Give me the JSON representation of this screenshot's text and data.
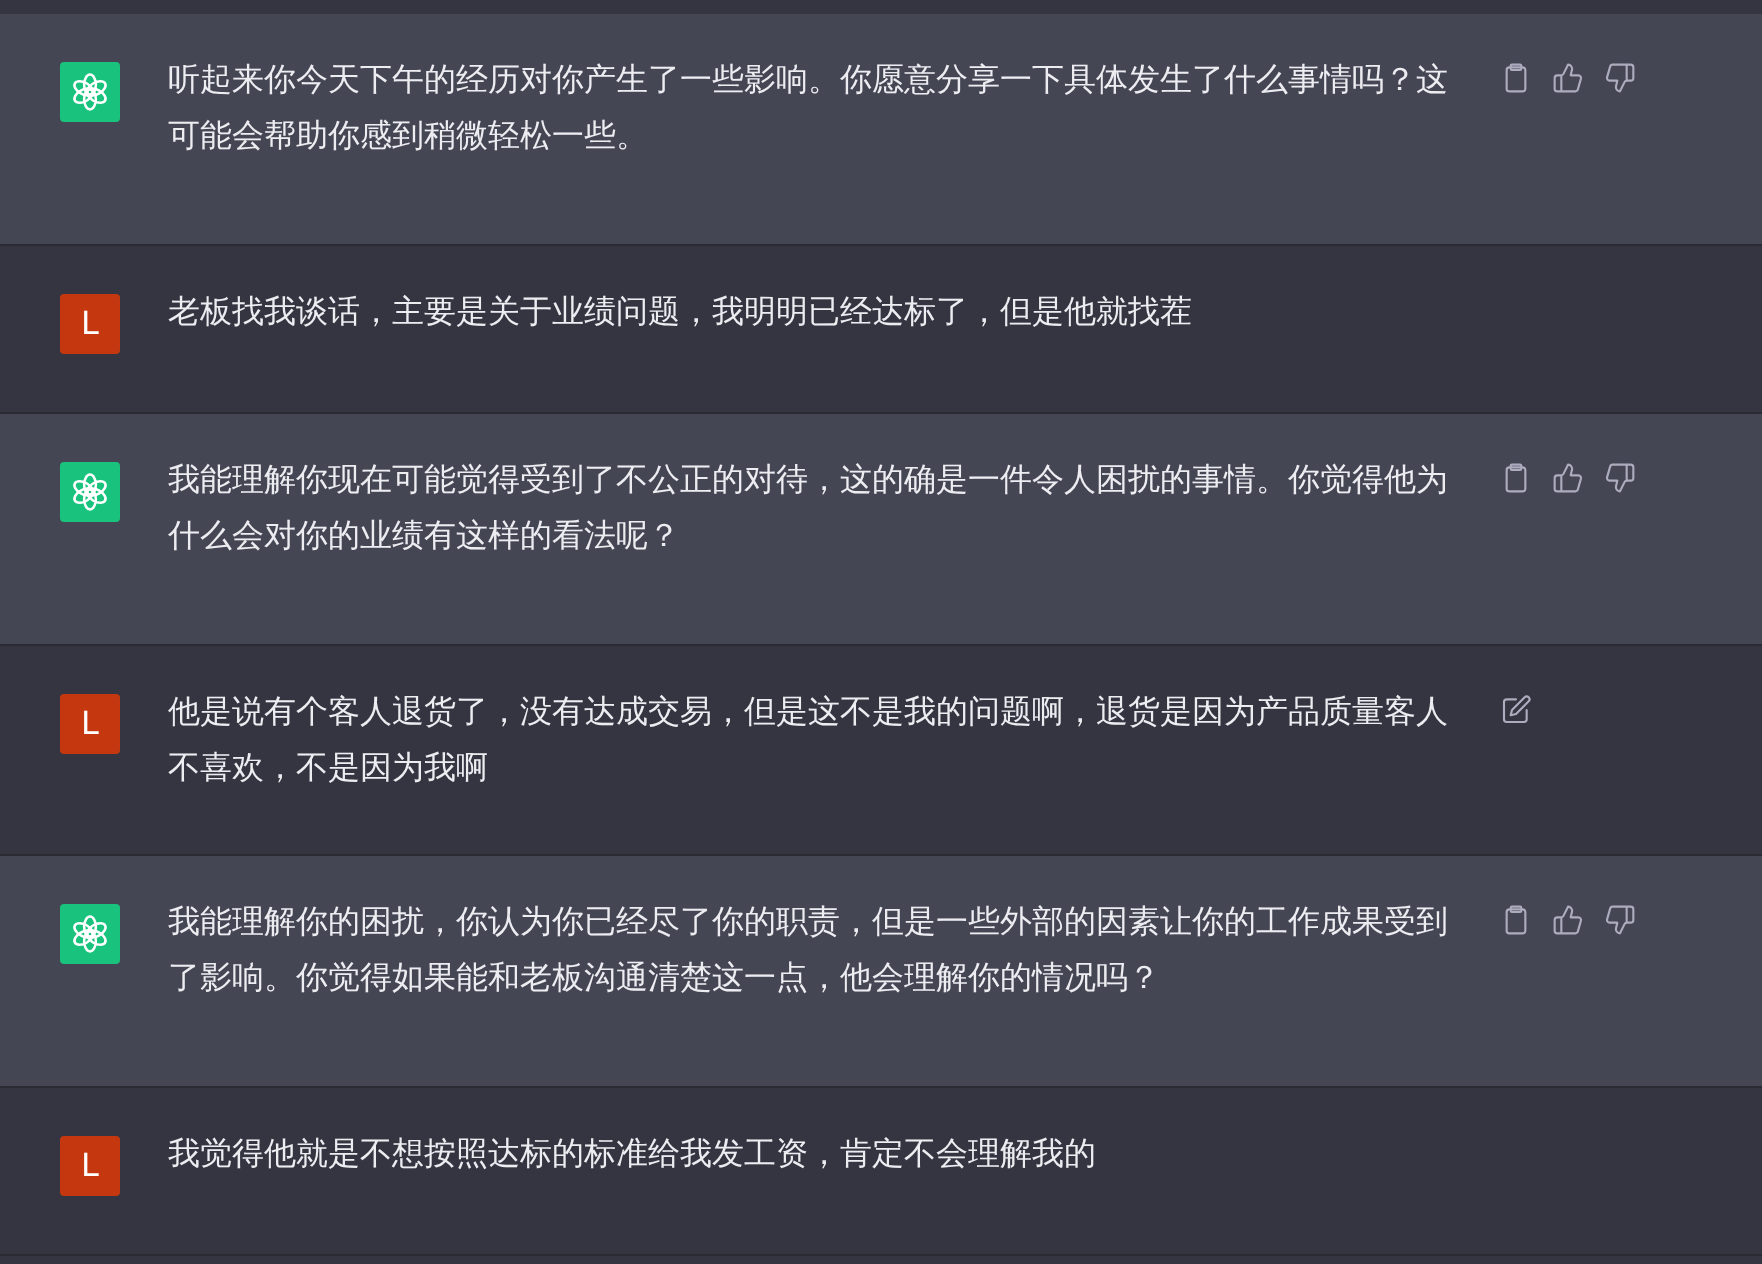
{
  "messages": [
    {
      "kind": "assistant",
      "text": "听起来你今天下午的经历对你产生了一些影响。你愿意分享一下具体发生了什么事情吗？这可能会帮助你感到稍微轻松一些。"
    },
    {
      "kind": "user",
      "avatar": "L",
      "text": "老板找我谈话，主要是关于业绩问题，我明明已经达标了，但是他就找茬"
    },
    {
      "kind": "assistant",
      "text": "我能理解你现在可能觉得受到了不公正的对待，这的确是一件令人困扰的事情。你觉得他为什么会对你的业绩有这样的看法呢？"
    },
    {
      "kind": "user",
      "avatar": "L",
      "text": "他是说有个客人退货了，没有达成交易，但是这不是我的问题啊，退货是因为产品质量客人不喜欢，不是因为我啊",
      "editable": true
    },
    {
      "kind": "assistant",
      "text": "我能理解你的困扰，你认为你已经尽了你的职责，但是一些外部的因素让你的工作成果受到了影响。你觉得如果能和老板沟通清楚这一点，他会理解你的情况吗？"
    },
    {
      "kind": "user",
      "avatar": "L",
      "text": "我觉得他就是不想按照达标的标准给我发工资，肯定不会理解我的"
    }
  ]
}
